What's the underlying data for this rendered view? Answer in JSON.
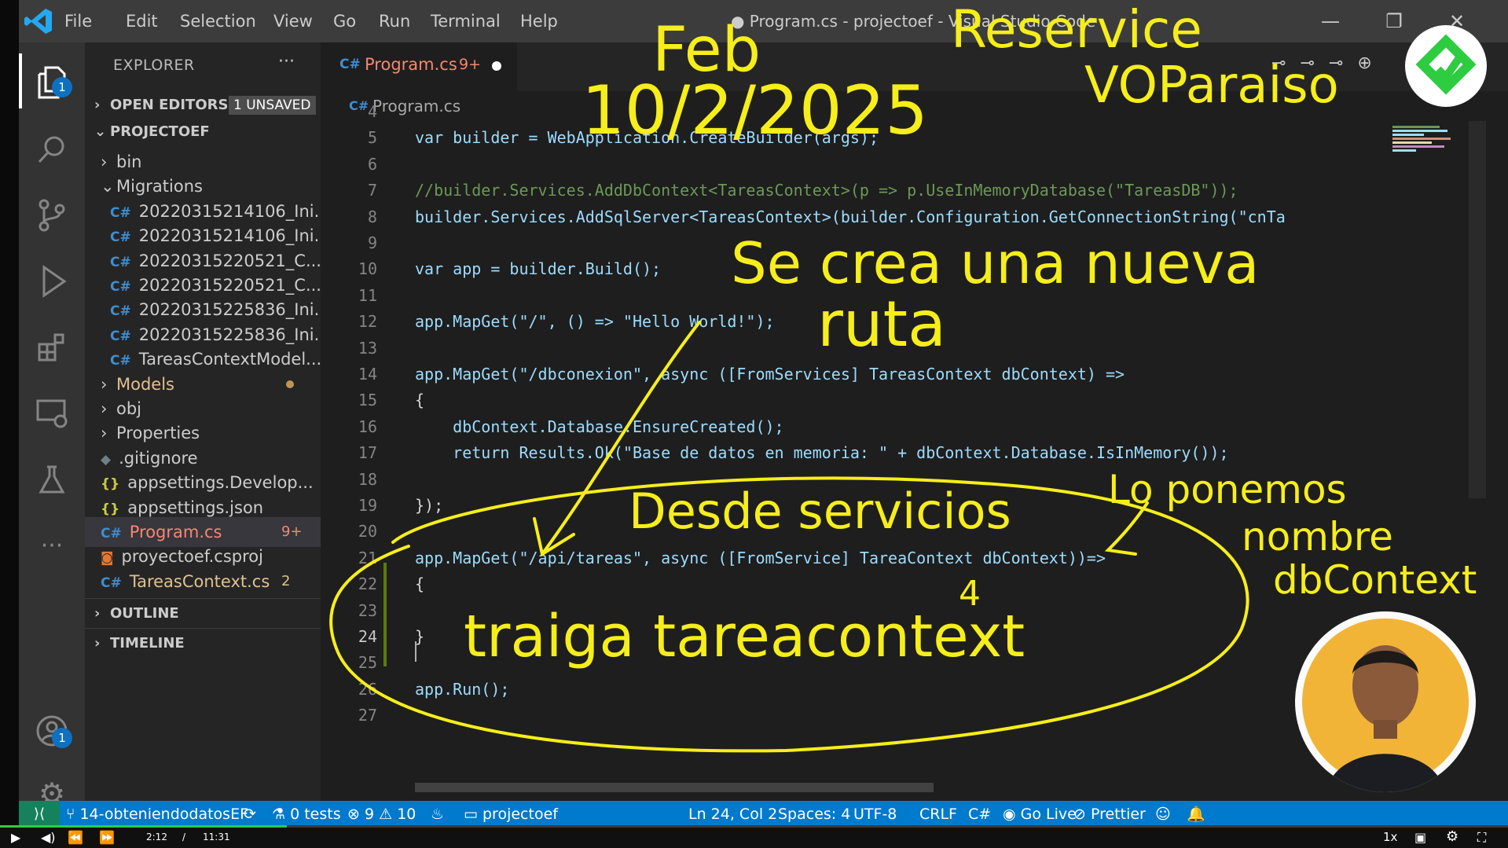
{
  "window": {
    "title": "● Program.cs - projectoef - Visual Studio Code",
    "menu": [
      "File",
      "Edit",
      "Selection",
      "View",
      "Go",
      "Run",
      "Terminal",
      "Help"
    ]
  },
  "activity_bar": {
    "icons": [
      "files-icon",
      "search-icon",
      "source-control-icon",
      "run-debug-icon",
      "extensions-icon",
      "remote-explorer-icon",
      "testing-icon",
      "more-icon",
      "account-icon",
      "settings-gear-icon"
    ],
    "explorer_badge": "1",
    "account_badge": "1"
  },
  "sidebar": {
    "header": "EXPLORER",
    "more": "···",
    "open_editors": "OPEN EDITORS",
    "unsaved_badge": "1 UNSAVED",
    "project": "PROJECTOEF",
    "items": [
      {
        "label": "bin",
        "type": "folder",
        "open": false
      },
      {
        "label": "Migrations",
        "type": "folder",
        "open": true
      },
      {
        "label": "20220315214106_Ini...",
        "type": "cs"
      },
      {
        "label": "20220315214106_Ini...",
        "type": "cs"
      },
      {
        "label": "20220315220521_C...",
        "type": "cs"
      },
      {
        "label": "20220315220521_C...",
        "type": "cs"
      },
      {
        "label": "20220315225836_Ini...",
        "type": "cs"
      },
      {
        "label": "20220315225836_Ini...",
        "type": "cs"
      },
      {
        "label": "TareasContextModel...",
        "type": "cs"
      },
      {
        "label": "Models",
        "type": "folder",
        "open": false,
        "modified": true
      },
      {
        "label": "obj",
        "type": "folder",
        "open": false
      },
      {
        "label": "Properties",
        "type": "folder",
        "open": false
      },
      {
        "label": ".gitignore",
        "type": "git"
      },
      {
        "label": "appsettings.Develop...",
        "type": "json"
      },
      {
        "label": "appsettings.json",
        "type": "json"
      },
      {
        "label": "Program.cs",
        "type": "cs",
        "badge": "9+",
        "selected": true
      },
      {
        "label": "proyectoef.csproj",
        "type": "rss"
      },
      {
        "label": "TareasContext.cs",
        "type": "cs",
        "badge": "2"
      }
    ],
    "outline": "OUTLINE",
    "timeline": "TIMELINE"
  },
  "editor": {
    "tab_label": "Program.cs",
    "tab_badge": "9+",
    "breadcrumb": "Program.cs",
    "lines": [
      {
        "n": "4",
        "text": ""
      },
      {
        "n": "5",
        "text": "var builder = WebApplication.CreateBuilder(args);"
      },
      {
        "n": "6",
        "text": ""
      },
      {
        "n": "7",
        "text": "//builder.Services.AddDbContext<TareasContext>(p => p.UseInMemoryDatabase(\"TareasDB\"));"
      },
      {
        "n": "8",
        "text": "builder.Services.AddSqlServer<TareasContext>(builder.Configuration.GetConnectionString(\"cnTa"
      },
      {
        "n": "9",
        "text": ""
      },
      {
        "n": "10",
        "text": "var app = builder.Build();"
      },
      {
        "n": "11",
        "text": ""
      },
      {
        "n": "12",
        "text": "app.MapGet(\"/\", () => \"Hello World!\");"
      },
      {
        "n": "13",
        "text": ""
      },
      {
        "n": "14",
        "text": "app.MapGet(\"/dbconexion\", async ([FromServices] TareasContext dbContext) =>"
      },
      {
        "n": "15",
        "text": "{"
      },
      {
        "n": "16",
        "text": "    dbContext.Database.EnsureCreated();"
      },
      {
        "n": "17",
        "text": "    return Results.Ok(\"Base de datos en memoria: \" + dbContext.Database.IsInMemory());"
      },
      {
        "n": "18",
        "text": ""
      },
      {
        "n": "19",
        "text": "});"
      },
      {
        "n": "20",
        "text": ""
      },
      {
        "n": "21",
        "text": "app.MapGet(\"/api/tareas\", async ([FromService] TareaContext dbContext))=>"
      },
      {
        "n": "22",
        "text": "{"
      },
      {
        "n": "23",
        "text": ""
      },
      {
        "n": "24",
        "text": "}"
      },
      {
        "n": "25",
        "text": ""
      },
      {
        "n": "26",
        "text": "app.Run();"
      },
      {
        "n": "27",
        "text": ""
      }
    ]
  },
  "status_bar": {
    "branch": "14-obteniendodatosEF",
    "tests": "0 tests",
    "errors": "9",
    "warnings": "10",
    "folder": "projectoef",
    "position": "Ln 24, Col 2",
    "spaces": "Spaces: 4",
    "encoding": "UTF-8",
    "eol": "CRLF",
    "language": "C#",
    "golive": "Go Live",
    "prettier": "Prettier"
  },
  "video": {
    "current": "2:12",
    "sep": "/",
    "total": "11:31",
    "speed": "1x",
    "progress": 0.19
  },
  "annotations": {
    "color": "#f6ee1a",
    "texts": [
      "Feb",
      "10/2/2025",
      "Reservice",
      "VOParaiso",
      "Se crea una nueva",
      "ruta",
      "Desde servicios",
      "Lo ponemos",
      "nombre",
      "dbContext",
      "traiga tareacontext",
      "4"
    ]
  }
}
